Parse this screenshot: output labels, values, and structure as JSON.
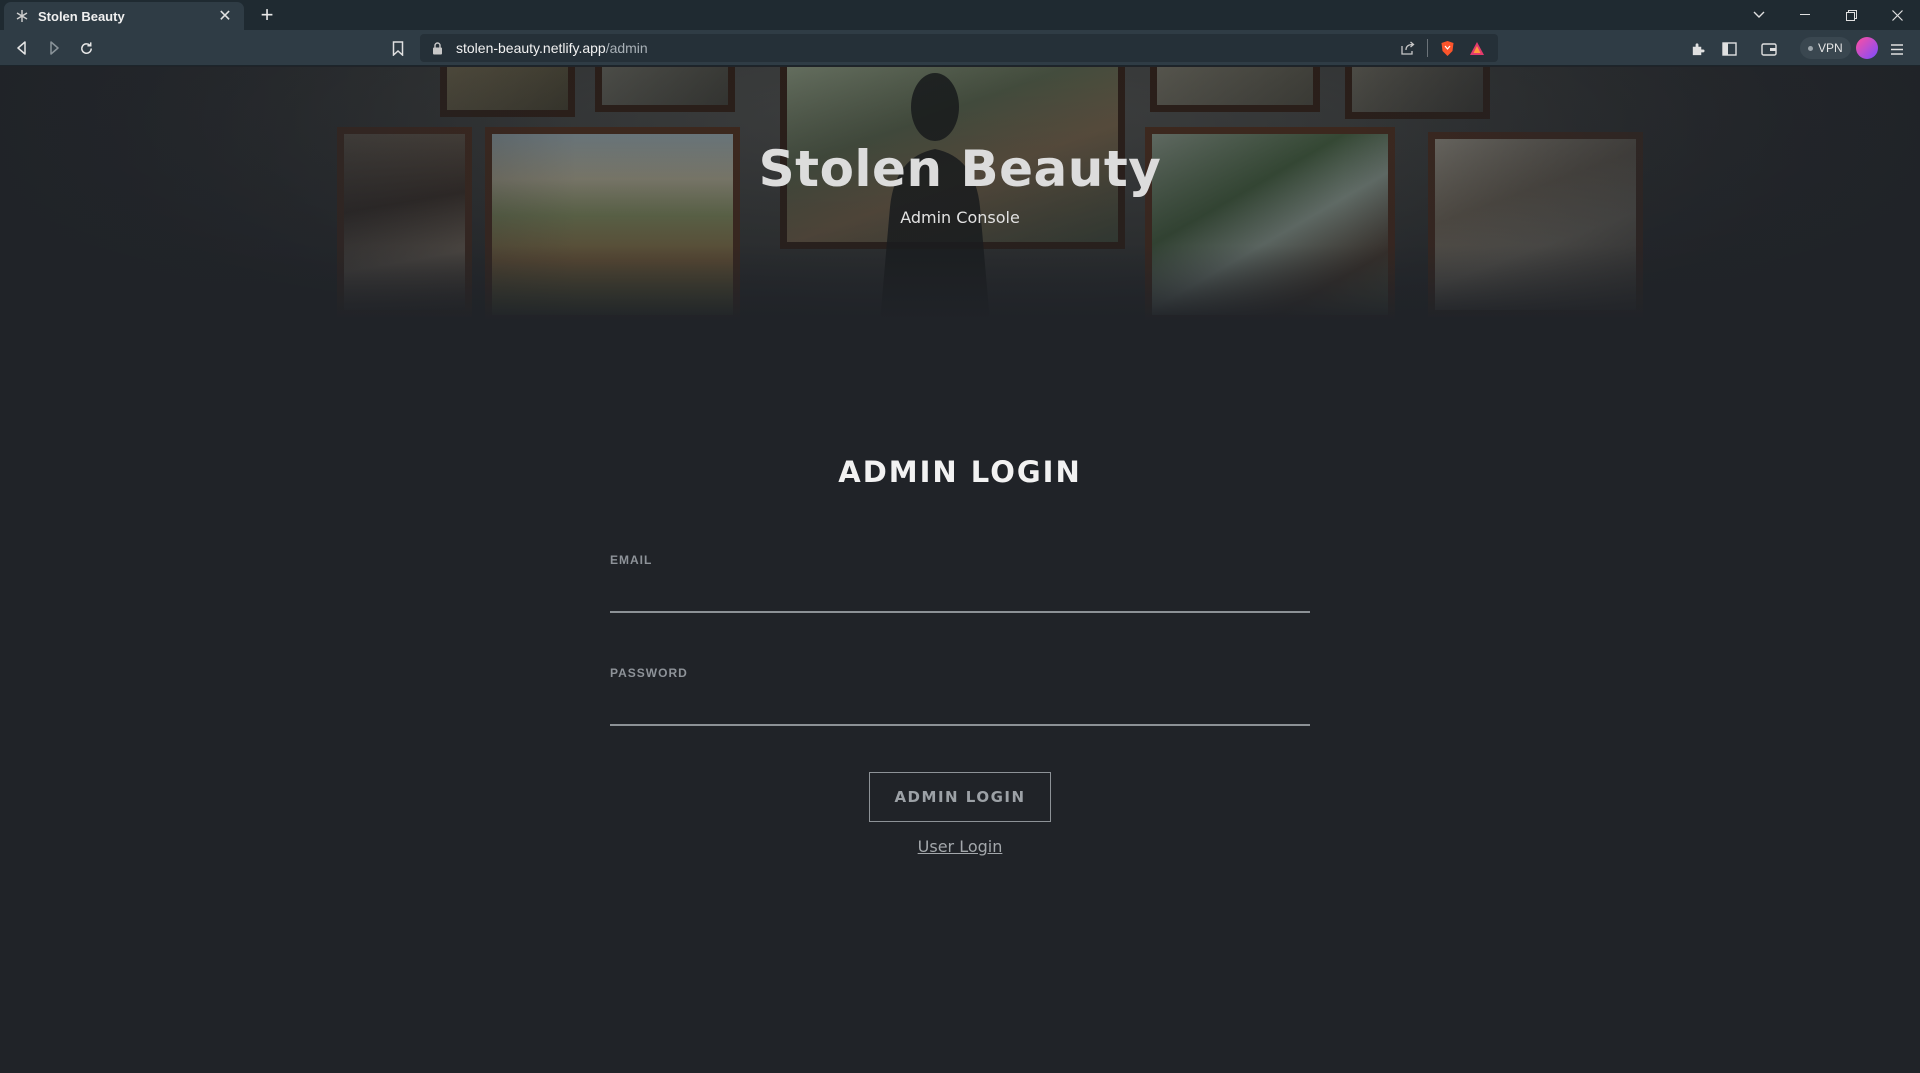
{
  "browser": {
    "tab": {
      "title": "Stolen Beauty"
    },
    "url": {
      "host": "stolen-beauty.netlify.app",
      "path": "/admin"
    },
    "vpn_label": "VPN",
    "icons": [
      "back-icon",
      "forward-icon",
      "reload-icon",
      "bookmark-icon",
      "lock-icon",
      "share-icon",
      "brave-shield-icon",
      "brave-rewards-icon",
      "extensions-icon",
      "sidebar-icon",
      "wallet-icon",
      "menu-icon"
    ]
  },
  "hero": {
    "title": "Stolen Beauty",
    "subtitle": "Admin Console"
  },
  "form": {
    "heading": "ADMIN LOGIN",
    "email_label": "EMAIL",
    "email_value": "",
    "password_label": "PASSWORD",
    "password_value": "",
    "submit_label": "ADMIN LOGIN",
    "user_login_link": "User Login"
  },
  "colors": {
    "page_bg": "#202328",
    "chrome_tab_bg": "#2f3c45",
    "tabbar_bg": "#1f2a31",
    "text_primary": "#f2f2f2",
    "text_muted": "#8e9399"
  }
}
